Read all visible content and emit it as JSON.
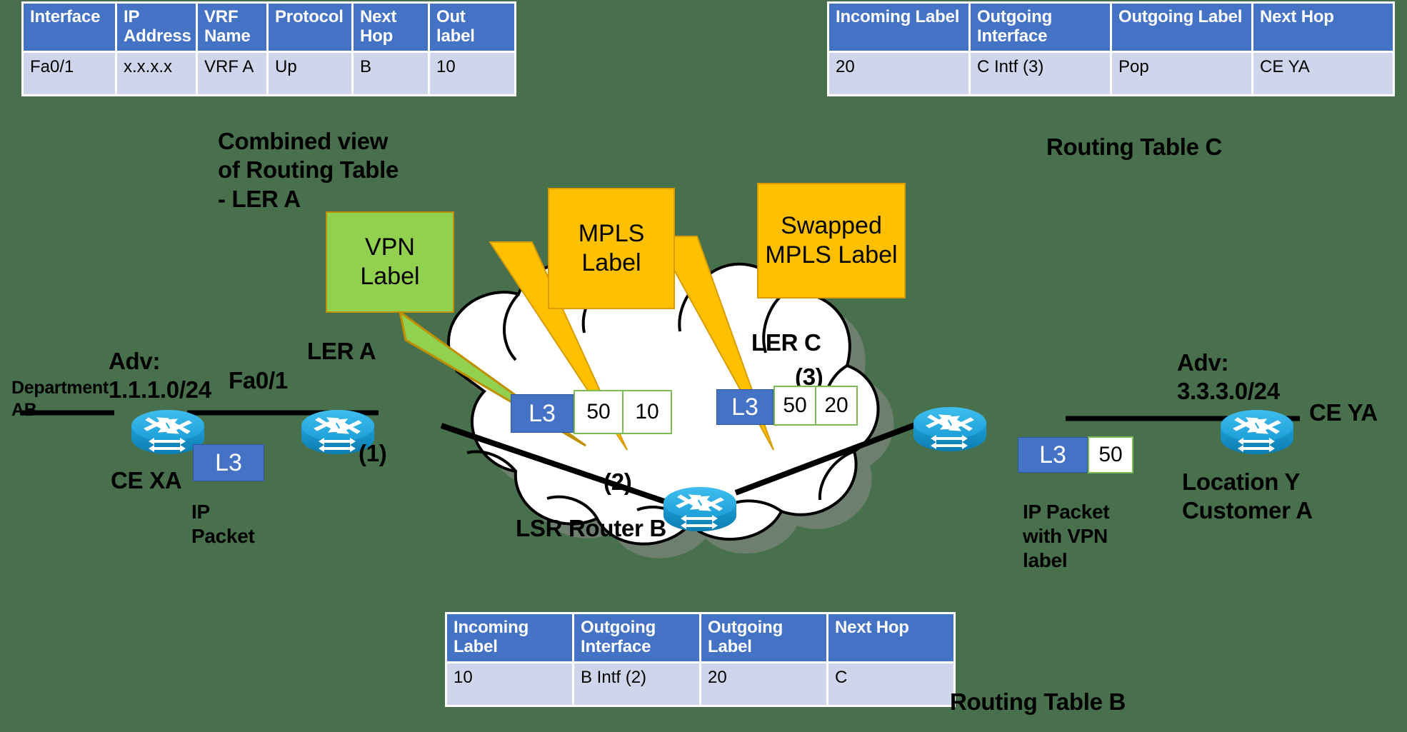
{
  "background_color": "#48704C",
  "theme": {
    "header_blue": "#4472C4",
    "row_lavender": "#CFD5EA",
    "callout_green": "#92D050",
    "callout_orange": "#FFC000",
    "label_border_green": "#7DBB55",
    "router_cyan": "#27A9E1"
  },
  "tables": {
    "lera": {
      "caption": "Combined view\nof Routing Table\n- LER A",
      "headers": [
        "Interface",
        "IP\nAddress",
        "VRF\nName",
        "Protocol",
        "Next\nHop",
        "Out label"
      ],
      "rows": [
        [
          "Fa0/1",
          "x.x.x.x",
          "VRF A",
          "Up",
          "B",
          "10"
        ]
      ]
    },
    "c": {
      "caption": "Routing Table C",
      "headers": [
        "Incoming\nLabel",
        "Outgoing\nInterface",
        "Outgoing\nLabel",
        "Next Hop"
      ],
      "rows": [
        [
          "20",
          "C Intf (3)",
          "Pop",
          "CE YA"
        ]
      ]
    },
    "b": {
      "caption": "Routing Table B",
      "headers": [
        "Incoming\nLabel",
        "Outgoing\nInterface",
        "Outgoing\nLabel",
        "Next Hop"
      ],
      "rows": [
        [
          "10",
          "B Intf (2)",
          "20",
          "C"
        ]
      ]
    }
  },
  "callouts": {
    "vpn": "VPN\nLabel",
    "mpls": "MPLS\nLabel",
    "swapped": "Swapped\nMPLS Label"
  },
  "nodes": {
    "ce_xa": {
      "name": "CE XA",
      "department": "Department\nAB",
      "advertise": "Adv:\n1.1.1.0/24"
    },
    "ler_a": {
      "name": "LER A",
      "interface": "Fa0/1",
      "port": "(1)"
    },
    "lsr_b": {
      "name": "LSR Router B",
      "port": "(2)"
    },
    "ler_c": {
      "name": "LER C",
      "port": "(3)"
    },
    "ce_ya": {
      "name": "CE YA",
      "advertise": "Adv:\n3.3.3.0/24",
      "location": "Location Y\nCustomer A"
    }
  },
  "packets": {
    "ip_packet": {
      "caption": "IP\nPacket",
      "l3": "L3",
      "labels": []
    },
    "labeled_in": {
      "l3": "L3",
      "labels": [
        "50",
        "10"
      ]
    },
    "labeled_swapped": {
      "l3": "L3",
      "labels": [
        "50",
        "20"
      ]
    },
    "vpn_only": {
      "caption": "IP Packet\nwith VPN\nlabel",
      "l3": "L3",
      "labels": [
        "50"
      ]
    }
  }
}
